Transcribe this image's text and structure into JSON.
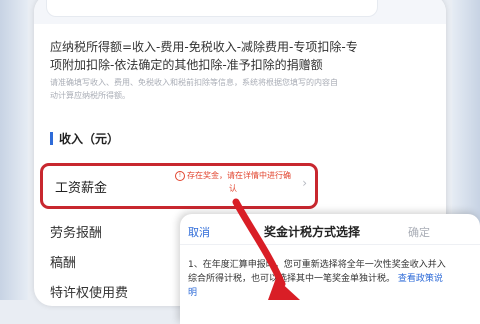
{
  "formula": "应纳税所得额=收入-费用-免税收入-减除费用-专项扣除-专项附加扣除-依法确定的其他扣除-准予扣除的捐赠额",
  "hint": "请准确填写收入、费用、免税收入和税前扣除等信息，系统将根据您填写的内容自动计算应纳税所得额。",
  "income_section": {
    "title": "收入（元）"
  },
  "income_rows": [
    {
      "label": "工资薪金",
      "warning": "存在奖金，请在详情中进行确认"
    },
    {
      "label": "劳务报酬"
    },
    {
      "label": "稿酬"
    },
    {
      "label": "特许权使用费"
    }
  ],
  "bonus_sheet": {
    "cancel": "取消",
    "title": "奖金计税方式选择",
    "confirm": "确定",
    "description": "1、在年度汇算申报时，您可重新选择将全年一次性奖金收入并入综合所得计税，也可以选择其中一笔奖金单独计税。",
    "link": "查看政策说明"
  },
  "colors": {
    "accent": "#2e6bd8",
    "highlight": "#c8272f",
    "warning": "#e2452f"
  },
  "icons": [
    "warning-circle-icon",
    "chevron-right-icon",
    "red-arrow-annotation"
  ]
}
